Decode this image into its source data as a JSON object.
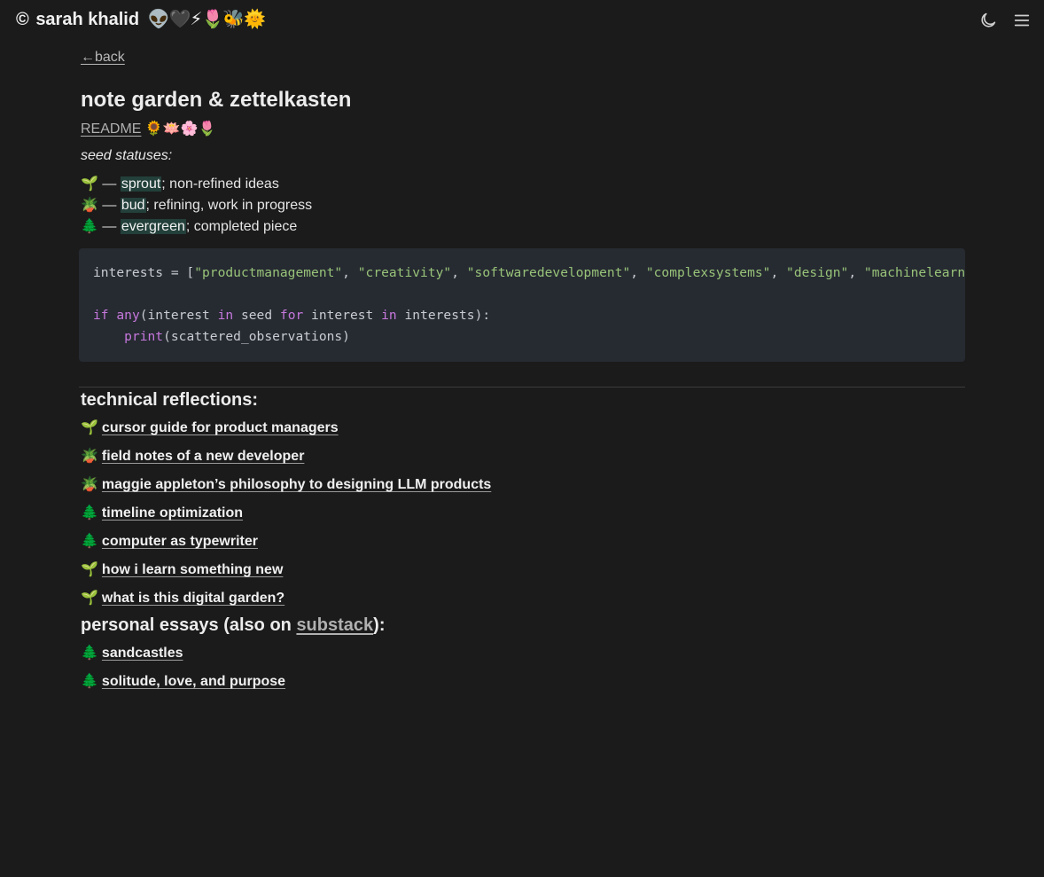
{
  "header": {
    "copyright_symbol": "©",
    "site_name": "sarah khalid",
    "emojis": "👽🖤⚡🌷🐝🌞",
    "moon_icon": "moon-icon",
    "menu_icon": "hamburger-menu-icon"
  },
  "nav": {
    "back_label": "←back"
  },
  "page": {
    "title": "note garden & zettelkasten",
    "readme_label": "README",
    "readme_emojis": "🌻🪷🌸🌷",
    "seed_heading": "seed statuses:"
  },
  "statuses": [
    {
      "emoji": "🌱",
      "dash": " — ",
      "name": "sprout",
      "desc": "; non-refined ideas"
    },
    {
      "emoji": "🪴",
      "dash": " — ",
      "name": "bud",
      "desc": "; refining, work in progress"
    },
    {
      "emoji": "🌲",
      "dash": " — ",
      "name": "evergreen",
      "desc": "; completed piece"
    }
  ],
  "code": {
    "var": "interests",
    "assign": " = [",
    "items": [
      "\"productmanagement\"",
      "\"creativity\"",
      "\"softwaredevelopment\"",
      "\"complexsystems\"",
      "\"design\"",
      "\"machinelearning\""
    ],
    "line2_if": "if",
    "line2_any": "any",
    "line2_a": "(interest ",
    "line2_in1": "in",
    "line2_b": " seed ",
    "line2_for": "for",
    "line2_c": " interest ",
    "line2_in2": "in",
    "line2_d": " interests):",
    "line3_print": "print",
    "line3_arg": "(scattered_observations)"
  },
  "technical": {
    "heading": "technical reflections:",
    "notes": [
      {
        "seed": "🌱",
        "title": "cursor guide for product managers"
      },
      {
        "seed": "🪴",
        "title": "field notes of a new developer"
      },
      {
        "seed": "🪴",
        "title": "maggie appleton’s philosophy to designing LLM products"
      },
      {
        "seed": "🌲",
        "title": "timeline optimization"
      },
      {
        "seed": "🌲",
        "title": "computer as typewriter"
      },
      {
        "seed": "🌱",
        "title": "how i learn something new"
      },
      {
        "seed": "🌱",
        "title": "what is this digital garden?"
      }
    ]
  },
  "essays": {
    "heading_pre": "personal essays (also on ",
    "substack_label": "substack",
    "heading_post": "):",
    "notes": [
      {
        "seed": "🌲",
        "title": "sandcastles"
      },
      {
        "seed": "🌲",
        "title": "solitude, love, and purpose"
      }
    ]
  },
  "colors": {
    "background": "#1b1b1b",
    "code_background": "#262a31",
    "highlight": "#23403a",
    "string": "#98c379",
    "keyword": "#c678dd"
  }
}
